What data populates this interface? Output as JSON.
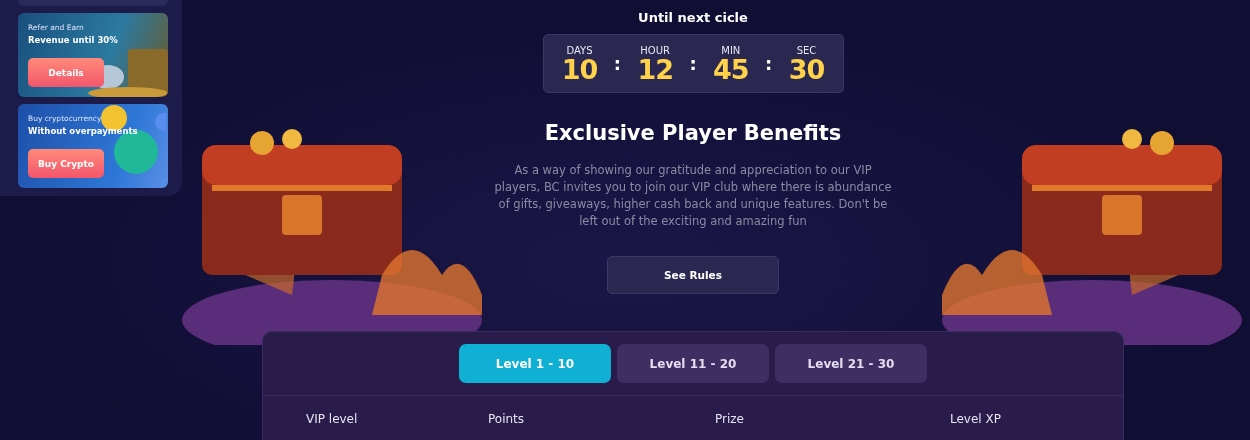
{
  "sidebar": {
    "promos": [
      {
        "kind": "refer",
        "caption": "Refer and Earn",
        "headline": "Revenue until 30%",
        "button": "Details"
      },
      {
        "kind": "crypto",
        "caption": "Buy cryptocurrency",
        "headline": "Without overpayments",
        "button": "Buy Crypto"
      }
    ]
  },
  "countdown": {
    "title": "Until next cicle",
    "units": [
      {
        "label": "DAYS",
        "value": "10"
      },
      {
        "label": "HOUR",
        "value": "12"
      },
      {
        "label": "MIN",
        "value": "45"
      },
      {
        "label": "SEC",
        "value": "30"
      }
    ],
    "separator": ":"
  },
  "benefits": {
    "heading": "Exclusive Player Benefits",
    "text": "As a way of showing our gratitude and appreciation to our VIP players, BC invites you to join our VIP club where there is abundance of gifts, giveaways, higher cash back and unique features. Don't be left out of the exciting and amazing fun",
    "button": "See Rules"
  },
  "levels": {
    "tabs": [
      {
        "label": "Level 1 - 10",
        "selected": true
      },
      {
        "label": "Level 11 - 20",
        "selected": false
      },
      {
        "label": "Level 21 - 30",
        "selected": false
      }
    ],
    "columns": [
      "VIP level",
      "Points",
      "Prize",
      "Level XP"
    ]
  }
}
